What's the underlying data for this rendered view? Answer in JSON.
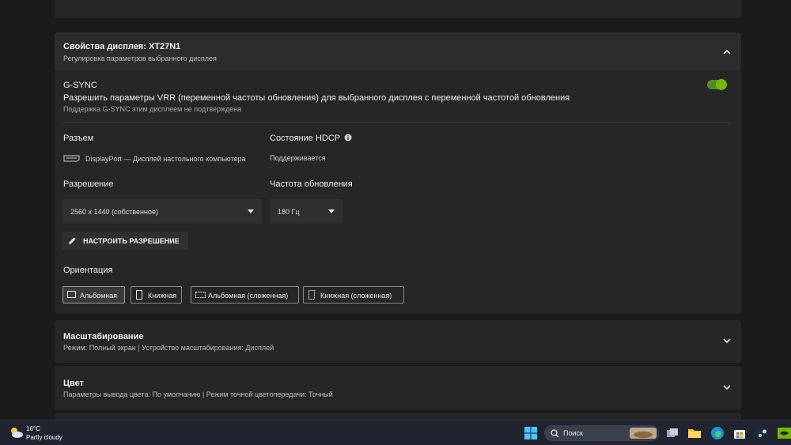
{
  "display_props": {
    "title": "Свойства дисплея: XT27N1",
    "subtitle": "Регулировка параметров выбранного дисплея"
  },
  "gsync": {
    "title": "G-SYNC",
    "description": "Разрешить параметры VRR (переменной частоты обновления) для выбранного дисплея с переменной частотой обновления",
    "note": "Поддержка G-SYNC этим дисплеем не подтверждена",
    "enabled": true
  },
  "connector": {
    "label": "Разъем",
    "value": "DisplayPort — Дисплей настольного компьютера"
  },
  "hdcp": {
    "label": "Состояние HDCP",
    "value": "Поддерживается"
  },
  "resolution": {
    "label": "Разрешение",
    "value": "2560 x 1440 (собственное)"
  },
  "refresh": {
    "label": "Частота обновления",
    "value": "180 Гц"
  },
  "configure_button": "НАСТРОИТЬ РАЗРЕШЕНИЕ",
  "orientation": {
    "label": "Ориентация",
    "options": [
      "Альбомная",
      "Книжная",
      "Альбомная (сложенная)",
      "Книжная (сложенная)"
    ],
    "selected": "Альбомная"
  },
  "scaling": {
    "title": "Масштабирование",
    "subtitle": "Режим: Полный экран | Устройство масштабирования: Дисплей"
  },
  "color": {
    "title": "Цвет",
    "subtitle": "Параметры вывода цвета: По умолчанию | Режим точной цветопередачи: Точный"
  },
  "taskbar": {
    "weather_temp": "16°C",
    "weather_text": "Partly cloudy",
    "search_placeholder": "Поиск",
    "icons": [
      "windows-start-icon",
      "task-view-icon",
      "file-explorer-icon",
      "edge-icon",
      "store-icon",
      "steam-icon",
      "nvidia-icon"
    ]
  },
  "colors": {
    "accent": "#76b900",
    "card": "#262626",
    "background": "#1b1b1b"
  }
}
